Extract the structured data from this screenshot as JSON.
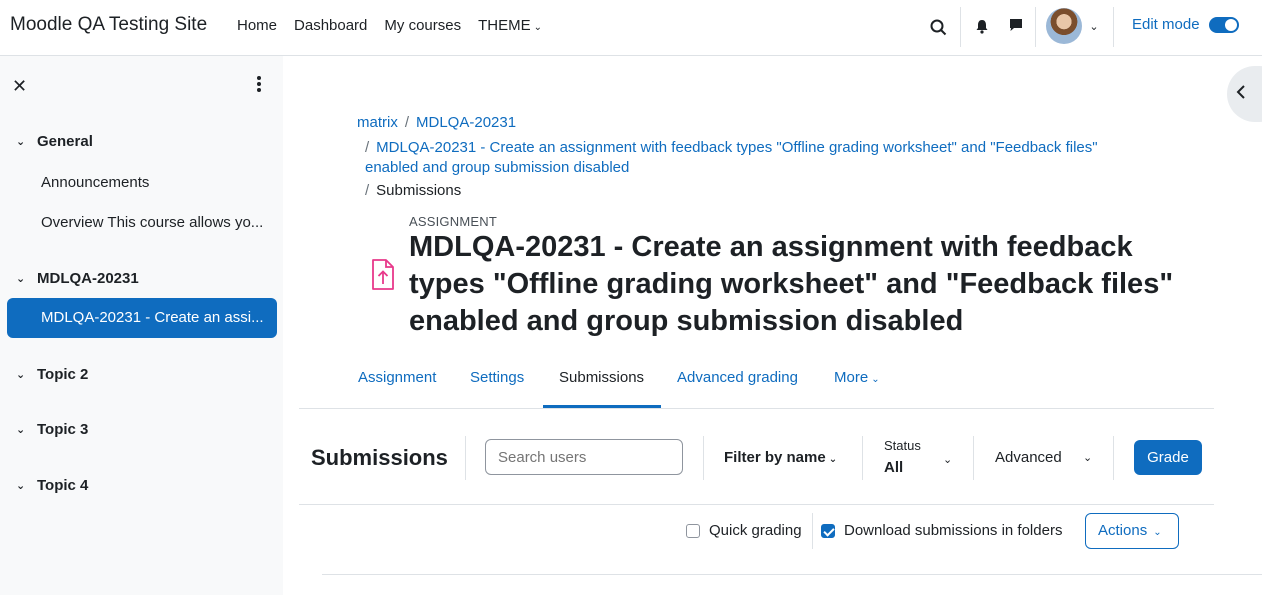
{
  "navbar": {
    "site_name": "Moodle QA Testing Site",
    "links": [
      "Home",
      "Dashboard",
      "My courses",
      "THEME"
    ],
    "edit_mode_label": "Edit mode",
    "edit_mode_on": true
  },
  "sidebar": {
    "sections": [
      {
        "title": "General",
        "items": [
          "Announcements",
          "Overview This course allows yo..."
        ]
      },
      {
        "title": "MDLQA-20231",
        "items": [
          "MDLQA-20231 - Create an assi..."
        ]
      },
      {
        "title": "Topic 2",
        "items": []
      },
      {
        "title": "Topic 3",
        "items": []
      },
      {
        "title": "Topic 4",
        "items": []
      }
    ],
    "active_item": "MDLQA-20231 - Create an assi..."
  },
  "breadcrumb": {
    "items": [
      "matrix",
      "MDLQA-20231",
      "MDLQA-20231 - Create an assignment with feedback types \"Offline grading worksheet\" and \"Feedback files\"",
      "enabled and group submission disabled",
      "Submissions"
    ]
  },
  "activity": {
    "type_label": "ASSIGNMENT",
    "title": "MDLQA-20231 - Create an assignment with feedback types \"Offline grading worksheet\" and \"Feedback files\" enabled and group submission disabled",
    "icon_color": "#e8398a"
  },
  "tabs": [
    "Assignment",
    "Settings",
    "Submissions",
    "Advanced grading",
    "More"
  ],
  "active_tab": "Submissions",
  "submissions_bar": {
    "title": "Submissions",
    "search_placeholder": "Search users",
    "filter_label": "Filter by name",
    "status_label": "Status",
    "status_value": "All",
    "advanced_label": "Advanced",
    "grade_button": "Grade"
  },
  "options": {
    "quick_grading_label": "Quick grading",
    "quick_grading_checked": false,
    "download_folders_label": "Download submissions in folders",
    "download_folders_checked": true,
    "actions_label": "Actions"
  },
  "colors": {
    "accent": "#0f6cbf",
    "text": "#1d2125",
    "muted": "#6a737b"
  }
}
